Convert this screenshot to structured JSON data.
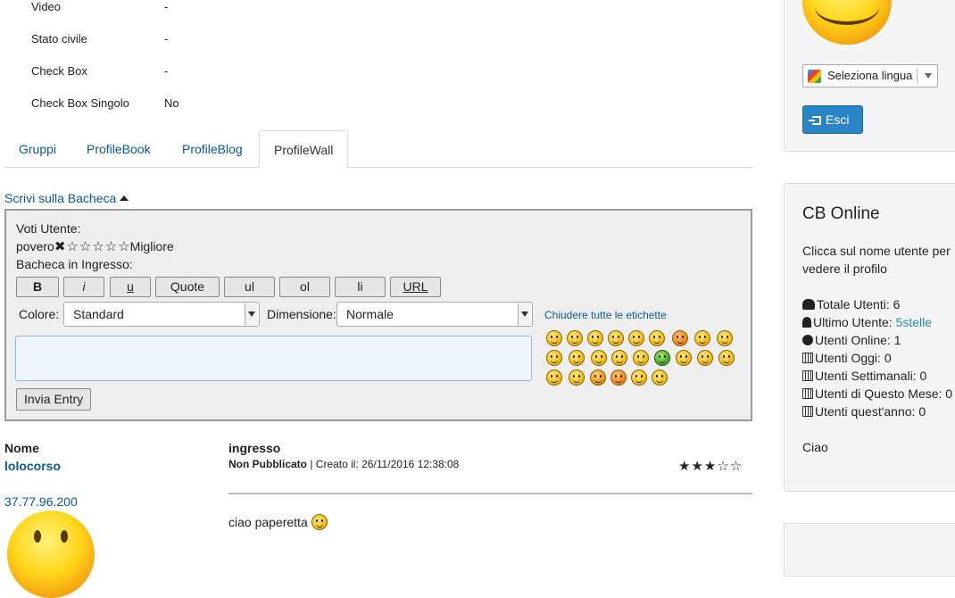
{
  "profile_fields": [
    {
      "label": "Video",
      "value": "-"
    },
    {
      "label": "Stato civile",
      "value": "-"
    },
    {
      "label": "Check Box",
      "value": "-"
    },
    {
      "label": "Check Box Singolo",
      "value": "No"
    }
  ],
  "tabs": [
    "Gruppi",
    "ProfileBook",
    "ProfileBlog",
    "ProfileWall"
  ],
  "wall": {
    "toggle": "Scrivi sulla Bacheca",
    "rating_label": "Voti Utente:",
    "rating_low": "povero",
    "rating_high": "Migliore",
    "inbox_label": "Bacheca in Ingresso:",
    "toolbar": [
      "B",
      "i",
      "u",
      "Quote",
      "ul",
      "ol",
      "li",
      "URL"
    ],
    "color_label": "Colore:",
    "color_value": "Standard",
    "size_label": "Dimensione:",
    "size_value": "Normale",
    "close_labels": "Chiudere tutte le etichette",
    "submit": "Invia Entry"
  },
  "entries_header": {
    "name": "Nome",
    "entry": "ingresso"
  },
  "entry": {
    "user": "lolocorso",
    "ip": "37.77.96.200",
    "status": "Non Pubblicato",
    "created": " | Creato il: 26/11/2016 12:38:08",
    "stars": "★★★☆☆",
    "rating": 3,
    "rating_max": 5,
    "message": "ciao paperetta"
  },
  "sidebar": {
    "language_select": "Seleziona lingua",
    "logout": "Esci",
    "online": {
      "title": "CB Online",
      "text_line1": "Clicca sul nome utente per",
      "text_line2": "vedere il profilo",
      "stats": [
        {
          "icon": "users-icon",
          "label": "Totale Utenti: ",
          "value": "6"
        },
        {
          "icon": "user-icon",
          "label": "Ultimo Utente: ",
          "value": "5stelle"
        },
        {
          "icon": "circle-icon",
          "label": "Utenti Online: ",
          "value": "1"
        },
        {
          "icon": "calendar-icon",
          "label": "Utenti Oggi: ",
          "value": "0"
        },
        {
          "icon": "calendar-icon",
          "label": "Utenti Settimanali: ",
          "value": "0"
        },
        {
          "icon": "calendar-icon",
          "label": "Utenti di Questo Mese: ",
          "value": "0"
        },
        {
          "icon": "calendar-icon",
          "label": "Utenti quest'anno: ",
          "value": "0"
        }
      ],
      "footer": "Ciao"
    }
  },
  "colors": {
    "link": "#0a5a8c",
    "button_primary": "#2a85c6",
    "panel_bg": "#f5f5f5",
    "wall_bg": "#eeeeee"
  }
}
